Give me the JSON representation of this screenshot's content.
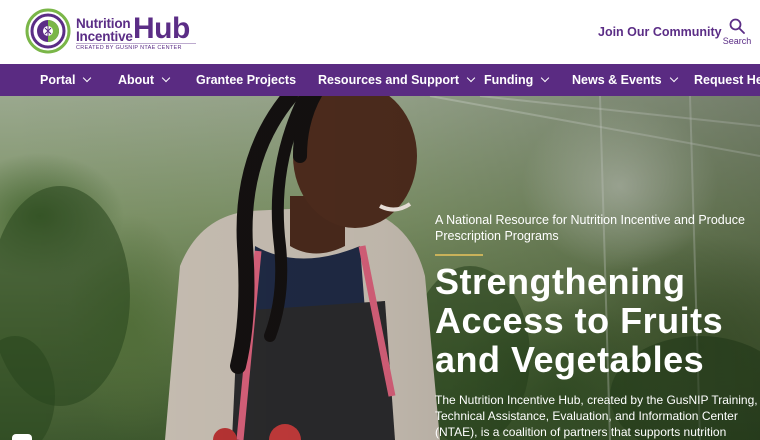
{
  "header": {
    "logo": {
      "line1": "Nutrition",
      "line2": "Incentive",
      "hub": "Hub",
      "tagline": "CREATED BY GUSNIP NTAE CENTER"
    },
    "join_label": "Join Our Community",
    "search_label": "Search"
  },
  "nav": {
    "items": [
      {
        "label": "Portal",
        "has_dropdown": true
      },
      {
        "label": "About",
        "has_dropdown": true
      },
      {
        "label": "Grantee Projects",
        "has_dropdown": false
      },
      {
        "label": "Resources and Support",
        "has_dropdown": true
      },
      {
        "label": "Funding",
        "has_dropdown": true
      },
      {
        "label": "News & Events",
        "has_dropdown": true
      },
      {
        "label": "Request Help",
        "has_dropdown": false
      }
    ]
  },
  "hero": {
    "eyebrow": "A National Resource for Nutrition Incentive and Produce Prescription Programs",
    "headline": "Strengthening Access to Fruits and Vegetables",
    "body": "The Nutrition Incentive Hub, created by the GusNIP Training, Technical Assistance, Evaluation, and Information Center (NTAE), is a coalition of partners that supports nutrition"
  },
  "colors": {
    "brand_purple": "#5a2b82",
    "logo_green": "#7ab648",
    "accent_gold": "#c9b25a"
  }
}
